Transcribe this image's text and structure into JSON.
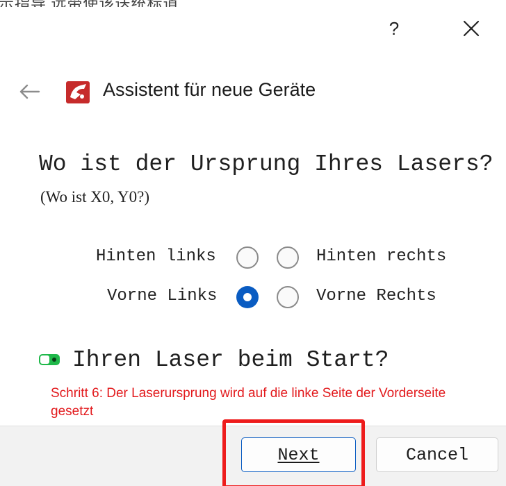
{
  "background_text": "示指导  远带使该送统标道",
  "titlebar": {
    "help_label": "?",
    "close_icon": "close-icon"
  },
  "header": {
    "back_icon": "arrow-left-icon",
    "logo_icon": "app-logo-icon",
    "title": "Assistent für neue Geräte"
  },
  "question": {
    "title": "Wo ist der Ursprung Ihres Lasers?",
    "subtitle": "(Wo ist X0, Y0?)"
  },
  "origin_options": [
    {
      "label": "Hinten links",
      "selected": false
    },
    {
      "label": "Hinten rechts",
      "selected": false
    },
    {
      "label": "Vorne Links",
      "selected": true
    },
    {
      "label": "Vorne Rechts",
      "selected": false
    }
  ],
  "start_option": {
    "icon": "toggle-icon",
    "label": "Ihren Laser beim Start?"
  },
  "annotation": {
    "text": "Schritt 6: Der Laserursprung wird auf die linke Seite der Vorderseite gesetzt"
  },
  "footer": {
    "next_label": "Next",
    "cancel_label": "Cancel"
  },
  "colors": {
    "accent": "#0a5cc2",
    "annotation": "#e2191c",
    "toggle": "#1fb84a",
    "logo": "#c62b2b"
  }
}
